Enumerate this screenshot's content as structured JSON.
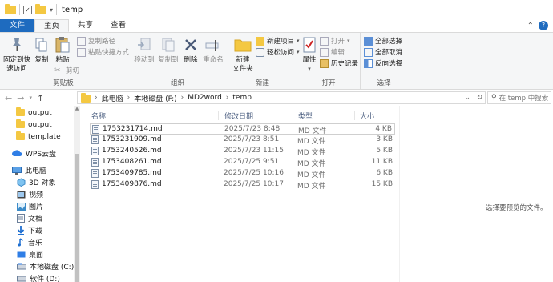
{
  "window": {
    "title": "temp"
  },
  "ribbon_tabs": {
    "file": "文件",
    "home": "主页",
    "share": "共享",
    "view": "查看"
  },
  "ribbon": {
    "clipboard": {
      "pin": "固定到快速访问",
      "pin_line1": "固定到快",
      "pin_line2": "速访问",
      "copy": "复制",
      "paste": "粘贴",
      "copy_path": "复制路径",
      "paste_shortcut": "粘贴快捷方式",
      "cut": "剪切",
      "label": "剪贴板"
    },
    "organize": {
      "move_to": "移动到",
      "copy_to": "复制到",
      "delete": "删除",
      "rename": "重命名",
      "label": "组织"
    },
    "new": {
      "new_folder_line1": "新建",
      "new_folder_line2": "文件夹",
      "new_item": "新建项目",
      "easy_access": "轻松访问",
      "label": "新建"
    },
    "open": {
      "properties": "属性",
      "open": "打开",
      "edit": "编辑",
      "history": "历史记录",
      "label": "打开"
    },
    "select": {
      "select_all": "全部选择",
      "select_none": "全部取消",
      "invert": "反向选择",
      "label": "选择"
    }
  },
  "address": {
    "crumbs": [
      "此电脑",
      "本地磁盘 (F:)",
      "MD2word",
      "temp"
    ],
    "search_placeholder": "在 temp 中搜索"
  },
  "sidebar": {
    "items": [
      {
        "label": "output",
        "icon": "folder-icon"
      },
      {
        "label": "output",
        "icon": "folder-icon"
      },
      {
        "label": "template",
        "icon": "folder-icon"
      },
      {
        "label": "WPS云盘",
        "icon": "cloud-icon"
      },
      {
        "label": "此电脑",
        "icon": "computer-icon"
      },
      {
        "label": "3D 对象",
        "icon": "cube-icon"
      },
      {
        "label": "视频",
        "icon": "video-icon"
      },
      {
        "label": "图片",
        "icon": "picture-icon"
      },
      {
        "label": "文档",
        "icon": "document-icon"
      },
      {
        "label": "下载",
        "icon": "download-icon"
      },
      {
        "label": "音乐",
        "icon": "music-icon"
      },
      {
        "label": "桌面",
        "icon": "desktop-icon"
      },
      {
        "label": "本地磁盘 (C:)",
        "icon": "drive-icon"
      },
      {
        "label": "软件 (D:)",
        "icon": "drive-icon"
      }
    ]
  },
  "filelist": {
    "columns": {
      "name": "名称",
      "date": "修改日期",
      "type": "类型",
      "size": "大小"
    },
    "rows": [
      {
        "name": "1753231714.md",
        "date": "2025/7/23 8:48",
        "type": "MD 文件",
        "size": "4 KB"
      },
      {
        "name": "1753231909.md",
        "date": "2025/7/23 8:51",
        "type": "MD 文件",
        "size": "3 KB"
      },
      {
        "name": "1753240526.md",
        "date": "2025/7/23 11:15",
        "type": "MD 文件",
        "size": "5 KB"
      },
      {
        "name": "1753408261.md",
        "date": "2025/7/25 9:51",
        "type": "MD 文件",
        "size": "11 KB"
      },
      {
        "name": "1753409785.md",
        "date": "2025/7/25 10:16",
        "type": "MD 文件",
        "size": "6 KB"
      },
      {
        "name": "1753409876.md",
        "date": "2025/7/25 10:17",
        "type": "MD 文件",
        "size": "15 KB"
      }
    ]
  },
  "preview": {
    "empty_text": "选择要预览的文件。"
  },
  "colors": {
    "accent": "#1e6bbf",
    "folder": "#f4c842"
  }
}
